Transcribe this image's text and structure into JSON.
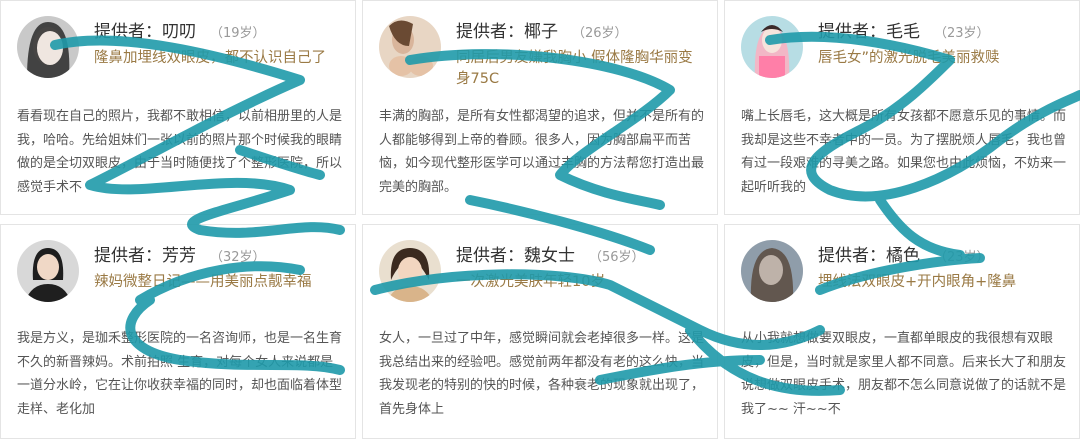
{
  "cards": [
    {
      "name": "提供者：叨叨",
      "age": "（19岁）",
      "title": "隆鼻加埋线双眼皮，都不认识自己了",
      "body": "看看现在自己的照片，我都不敢相信，以前相册里的人是我，哈哈。先给姐妹们一张以前的照片那个时候我的眼睛做的是全切双眼皮，由于当时随便找了个整形医院，所以感觉手术不"
    },
    {
      "name": "提供者：椰子",
      "age": "（26岁）",
      "title": "同居后男友嫌我胸小 假体隆胸华丽变身75C",
      "body": "丰满的胸部，是所有女性都渴望的追求，但并不是所有的人都能够得到上帝的眷顾。很多人，因为胸部扁平而苦恼，如今现代整形医学可以通过丰胸的方法帮您打造出最完美的胸部。"
    },
    {
      "name": "提供者：毛毛",
      "age": "（23岁）",
      "title": "唇毛女”的激光脱毛美丽救赎",
      "body": "嘴上长唇毛，这大概是所有女孩都不愿意乐见的事情。而我却是这些不幸者中的一员。为了摆脱烦人唇毛，我也曾有过一段艰难的寻美之路。如果您也由此烦恼，不妨来一起听听我的"
    },
    {
      "name": "提供者：芳芳",
      "age": "（32岁）",
      "title": "辣妈微整日记——用美丽点靓幸福",
      "body": "我是方义，是珈禾整形医院的一名咨询师，也是一名生育不久的新晋辣妈。术前拍照 生育，对每个女人来说都是一道分水岭，它在让你收获幸福的同时，却也面临着体型走样、老化加"
    },
    {
      "name": "提供者：魏女士",
      "age": "（56岁）",
      "title": "一次激光美肤年轻10岁",
      "body": "女人，一旦过了中年，感觉瞬间就会老掉很多一样。这是我总结出来的经验吧。感觉前两年都没有老的这么快，当我发现老的特别的快的时候，各种衰老的现象就出现了，首先身体上"
    },
    {
      "name": "提供者：橘色",
      "age": "（23岁）",
      "title": "埋线法双眼皮+开内眼角+隆鼻",
      "body": "从小我就想做要双眼皮，一直都单眼皮的我很想有双眼皮，但是，当时就是家里人都不同意。后来长大了和朋友说想做双眼皮手术，朋友都不怎么同意说做了的话就不是我了~~ 汗~~不"
    }
  ]
}
